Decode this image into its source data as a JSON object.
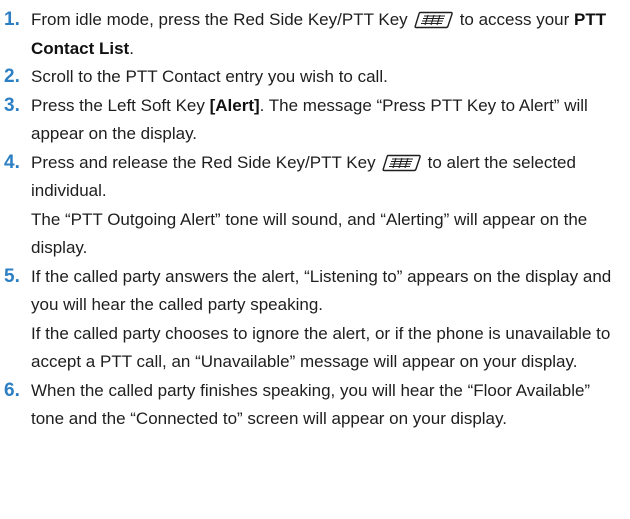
{
  "steps": [
    {
      "num": "1.",
      "pre": "From idle mode, press the Red Side Key/PTT Key",
      "post": "to access your ",
      "bold": "PTT Contact List",
      "end": ".",
      "icon": "ptt-key-icon"
    },
    {
      "num": "2.",
      "text": "Scroll to the PTT Contact entry you wish to call."
    },
    {
      "num": "3.",
      "pre": "Press the Left Soft Key ",
      "bold": "[Alert]",
      "post": ". The message “Press PTT Key to Alert” will appear on the display."
    },
    {
      "num": "4.",
      "pre": "Press and release the Red Side Key/PTT Key",
      "post": "to alert the selected individual.",
      "sub": "The “PTT Outgoing Alert” tone will sound, and “Alerting” will appear on the display.",
      "icon": "ptt-key-icon"
    },
    {
      "num": "5.",
      "text": "If the called party answers the alert, “Listening to” appears on the display and you will hear the called party speaking.",
      "sub": "If the called party chooses to ignore the alert, or if the phone is unavailable to accept a PTT call, an “Unavailable” message will appear on your display."
    },
    {
      "num": "6.",
      "text": "When the called party finishes speaking, you will hear the “Floor Available” tone and the “Connected to” screen will appear on your display."
    }
  ],
  "colors": {
    "step_number": "#2d7fc3",
    "text": "#1e1e1e"
  }
}
